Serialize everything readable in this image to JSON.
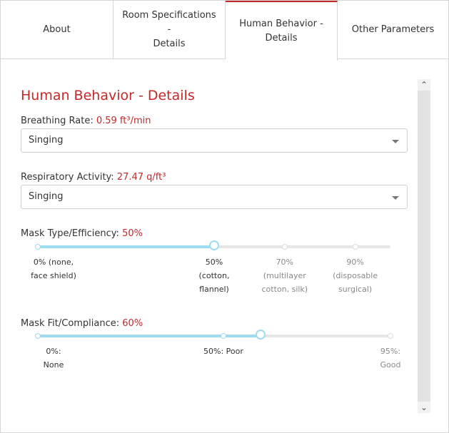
{
  "tabs": [
    {
      "label": "About",
      "active": false
    },
    {
      "label": "Room Specifications -\nDetails",
      "active": false
    },
    {
      "label": "Human Behavior -\nDetails",
      "active": true
    },
    {
      "label": "Other Parameters",
      "active": false
    }
  ],
  "section": {
    "title": "Human Behavior - Details",
    "breathing": {
      "label": "Breathing Rate:",
      "value_display": "0.59 ft³/min",
      "selected": "Singing"
    },
    "respiratory": {
      "label": "Respiratory Activity:",
      "value_display": "27.47 q/ft³",
      "selected": "Singing"
    },
    "mask_type": {
      "label": "Mask Type/Efficiency:",
      "value_display": "50%",
      "value_fraction": 0.5,
      "marks": [
        {
          "label": "0% (none,\nface shield)",
          "pos": 0.0
        },
        {
          "label": "50%\n(cotton,\nflannel)",
          "pos": 0.5
        },
        {
          "label": "70%\n(multilayer\ncotton, silk)",
          "pos": 0.7
        },
        {
          "label": "90%\n(disposable\nsurgical)",
          "pos": 0.9
        }
      ]
    },
    "mask_fit": {
      "label": "Mask Fit/Compliance:",
      "value_display": "60%",
      "value_fraction": 0.6316,
      "marks": [
        {
          "label": "0%:\nNone",
          "pos": 0.0
        },
        {
          "label": "50%: Poor",
          "pos": 0.5263
        },
        {
          "label": "95%:\nGood",
          "pos": 1.0
        }
      ]
    }
  },
  "colors": {
    "accent": "#c62828",
    "slider": "#9fdcf2"
  }
}
